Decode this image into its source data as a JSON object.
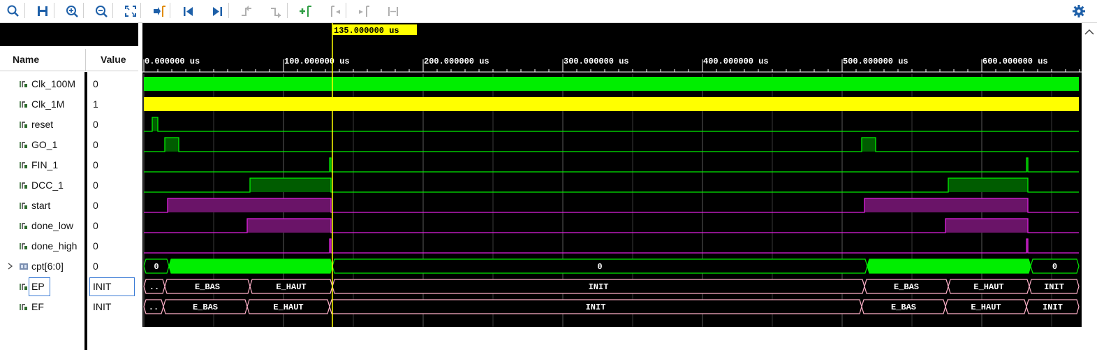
{
  "toolbar": {
    "buttons": [
      {
        "name": "search-icon",
        "color": "#1d5fa8"
      },
      {
        "name": "save-icon",
        "color": "#1d5fa8"
      },
      {
        "name": "zoom-in-icon",
        "color": "#1d5fa8"
      },
      {
        "name": "zoom-out-icon",
        "color": "#1d5fa8"
      },
      {
        "name": "zoom-fit-icon",
        "color": "#1d5fa8"
      },
      {
        "name": "go-to-cursor-icon",
        "color": "#1d5fa8"
      },
      {
        "name": "go-to-time-zero-icon",
        "color": "#1d5fa8"
      },
      {
        "name": "go-to-last-time-icon",
        "color": "#1d5fa8"
      },
      {
        "name": "previous-transition-icon",
        "color": "#b0b0b0"
      },
      {
        "name": "next-transition-icon",
        "color": "#b0b0b0"
      },
      {
        "name": "add-marker-icon",
        "color": "#2f9e44"
      },
      {
        "name": "previous-marker-icon",
        "color": "#b0b0b0"
      },
      {
        "name": "next-marker-icon",
        "color": "#b0b0b0"
      },
      {
        "name": "swap-cursors-icon",
        "color": "#b0b0b0"
      }
    ],
    "settings_icon": "gear-icon"
  },
  "columns": {
    "name": "Name",
    "value": "Value"
  },
  "cursor": {
    "label": "135.000000 us",
    "time_us": 135
  },
  "time_axis": {
    "ticks": [
      "0.000000 us",
      "100.000000 us",
      "200.000000 us",
      "300.000000 us",
      "400.000000 us",
      "500.000000 us",
      "600.000000 us"
    ]
  },
  "signals": [
    {
      "name": "Clk_100M",
      "value": "0",
      "icon": "bit-signal-icon"
    },
    {
      "name": "Clk_1M",
      "value": "1",
      "icon": "bit-signal-icon"
    },
    {
      "name": "reset",
      "value": "0",
      "icon": "bit-signal-icon"
    },
    {
      "name": "GO_1",
      "value": "0",
      "icon": "bit-signal-icon"
    },
    {
      "name": "FIN_1",
      "value": "0",
      "icon": "bit-signal-icon"
    },
    {
      "name": "DCC_1",
      "value": "0",
      "icon": "bit-signal-icon"
    },
    {
      "name": "start",
      "value": "0",
      "icon": "bit-signal-icon"
    },
    {
      "name": "done_low",
      "value": "0",
      "icon": "bit-signal-icon"
    },
    {
      "name": "done_high",
      "value": "0",
      "icon": "bit-signal-icon"
    },
    {
      "name": "cpt[6:0]",
      "value": "0",
      "icon": "bus-signal-icon"
    },
    {
      "name": "EP",
      "value": "INIT",
      "icon": "bit-signal-icon"
    },
    {
      "name": "EF",
      "value": "INIT",
      "icon": "bit-signal-icon"
    }
  ],
  "bus_labels": {
    "cpt": [
      "0",
      "0",
      "0"
    ],
    "ep": [
      "..",
      "E_BAS",
      "E_HAUT",
      "INIT",
      "E_BAS",
      "E_HAUT",
      "INIT"
    ],
    "ef": [
      "..",
      "E_BAS",
      "E_HAUT",
      "INIT",
      "E_BAS",
      "E_HAUT",
      "INIT"
    ]
  },
  "colors": {
    "digital": "#00ee00",
    "digital_fill": "#005c00",
    "clock_1m": "#ffff00",
    "magenta": "#e020e0",
    "magenta_fill": "#6a1468",
    "enum": "#ffb0c8",
    "cursor": "#ffff00",
    "grid": "#5a5a5a"
  }
}
